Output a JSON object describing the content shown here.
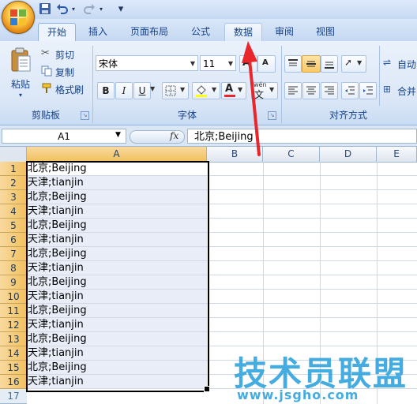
{
  "quick_access": {
    "save_icon": "save-icon",
    "undo_icon": "undo-icon",
    "redo_icon": "redo-icon",
    "customize": "▾"
  },
  "tabs": [
    {
      "label": "开始",
      "state": "active"
    },
    {
      "label": "插入",
      "state": "normal"
    },
    {
      "label": "页面布局",
      "state": "normal"
    },
    {
      "label": "公式",
      "state": "normal"
    },
    {
      "label": "数据",
      "state": "hover"
    },
    {
      "label": "审阅",
      "state": "normal"
    },
    {
      "label": "视图",
      "state": "normal"
    }
  ],
  "clipboard": {
    "paste_label": "粘贴",
    "cut_label": "剪切",
    "copy_label": "复制",
    "format_painter_label": "格式刷",
    "group_label": "剪贴板"
  },
  "font": {
    "name": "宋体",
    "size": "11",
    "bold": "B",
    "italic": "I",
    "underline": "U",
    "font_color_glyph": "A",
    "group_label": "字体",
    "size_up": "A",
    "size_down": "A",
    "wen": "wén"
  },
  "alignment": {
    "group_label": "对齐方式"
  },
  "right_cut": {
    "wrap_label": "自动",
    "merge_label": "合并"
  },
  "formula_bar": {
    "name_box": "A1",
    "fx": "fx",
    "content": "北京;Beijing"
  },
  "columns": [
    "A",
    "B",
    "C",
    "D",
    "E"
  ],
  "rows": [
    {
      "n": "1",
      "a": "北京;Beijing"
    },
    {
      "n": "2",
      "a": "天津;tianjin"
    },
    {
      "n": "3",
      "a": "北京;Beijing"
    },
    {
      "n": "4",
      "a": "天津;tianjin"
    },
    {
      "n": "5",
      "a": "北京;Beijing"
    },
    {
      "n": "6",
      "a": "天津;tianjin"
    },
    {
      "n": "7",
      "a": "北京;Beijing"
    },
    {
      "n": "8",
      "a": "天津;tianjin"
    },
    {
      "n": "9",
      "a": "北京;Beijing"
    },
    {
      "n": "10",
      "a": "天津;tianjin"
    },
    {
      "n": "11",
      "a": "北京;Beijing"
    },
    {
      "n": "12",
      "a": "天津;tianjin"
    },
    {
      "n": "13",
      "a": "北京;Beijing"
    },
    {
      "n": "14",
      "a": "天津;tianjin"
    },
    {
      "n": "15",
      "a": "北京;Beijing"
    },
    {
      "n": "16",
      "a": "天津;tianjin"
    }
  ],
  "extra_row": "17",
  "watermark": {
    "title": "技术员联盟",
    "url": "www.jsgho.com"
  },
  "colors": {
    "accent_red": "#e8262b",
    "selection_header": "#f1c05c",
    "selection_fill": "#e8edf8",
    "ribbon": "#dbe7f7"
  }
}
